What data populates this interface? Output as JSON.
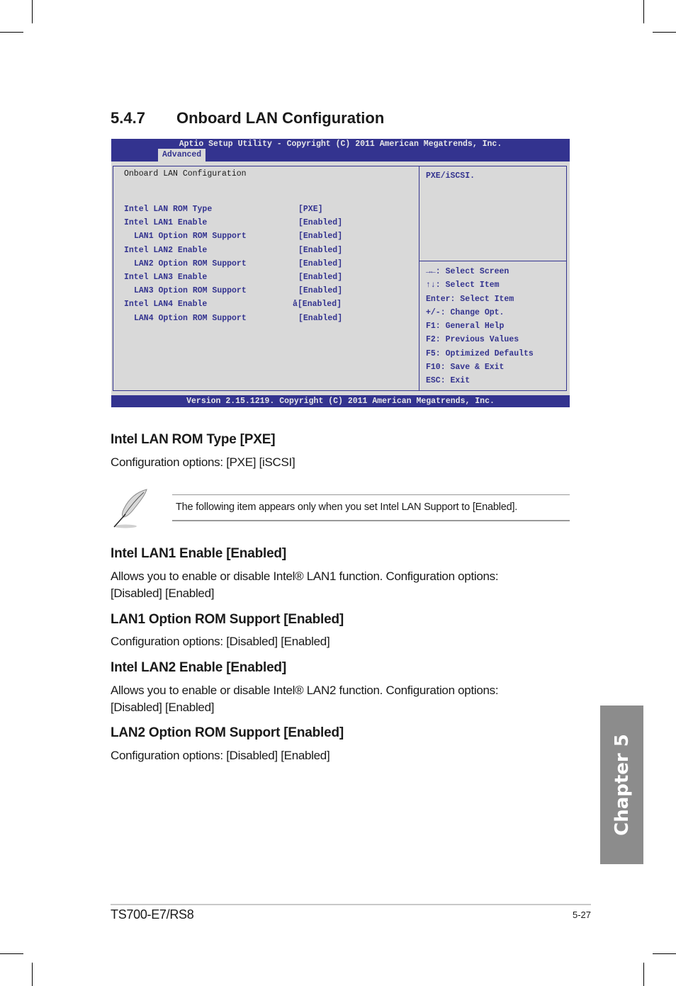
{
  "section": {
    "number": "5.4.7",
    "title": "Onboard LAN Configuration"
  },
  "bios": {
    "header_title": "Aptio Setup Utility - Copyright (C) 2011 American Megatrends, Inc.",
    "active_tab": "Advanced",
    "page_title": "Onboard LAN Configuration",
    "items": [
      {
        "label": "Intel LAN ROM Type",
        "value": "[PXE]",
        "indent": false
      },
      {
        "label": "Intel LAN1 Enable",
        "value": "[Enabled]",
        "indent": false
      },
      {
        "label": "LAN1 Option ROM Support",
        "value": "[Enabled]",
        "indent": true
      },
      {
        "label": "Intel LAN2 Enable",
        "value": "[Enabled]",
        "indent": false
      },
      {
        "label": "LAN2 Option ROM Support",
        "value": "[Enabled]",
        "indent": true
      },
      {
        "label": "Intel LAN3 Enable",
        "value": "[Enabled]",
        "indent": false
      },
      {
        "label": "LAN3 Option ROM Support",
        "value": "[Enabled]",
        "indent": true
      },
      {
        "label": "Intel LAN4 Enable",
        "value": "å[Enabled]",
        "indent": false
      },
      {
        "label": "LAN4 Option ROM Support",
        "value": "[Enabled]",
        "indent": true
      }
    ],
    "help_text": "PXE/iSCSI.",
    "key_help": [
      "→←: Select Screen",
      "↑↓: Select Item",
      "Enter: Select Item",
      "+/-: Change Opt.",
      "F1: General Help",
      "F2: Previous Values",
      "F5: Optimized Defaults",
      "F10: Save & Exit",
      "ESC: Exit"
    ],
    "footer": "Version 2.15.1219. Copyright (C) 2011 American Megatrends, Inc."
  },
  "sections": [
    {
      "heading": "Intel LAN ROM Type [PXE]",
      "body": "Configuration options: [PXE] [iSCSI]"
    },
    {
      "heading": "Intel LAN1 Enable [Enabled]",
      "body": "Allows you to enable or disable Intel® LAN1 function. Configuration options: [Disabled] [Enabled]"
    },
    {
      "heading": "LAN1 Option ROM Support [Enabled]",
      "body": "Configuration options: [Disabled] [Enabled]"
    },
    {
      "heading": "Intel LAN2 Enable [Enabled]",
      "body": "Allows you to enable or disable Intel® LAN2 function. Configuration options: [Disabled] [Enabled]"
    },
    {
      "heading": "LAN2 Option ROM Support [Enabled]",
      "body": "Configuration options: [Disabled] [Enabled]"
    }
  ],
  "note": {
    "icon": "pencil-note-icon",
    "text": "The following item appears only when you set Intel LAN Support to [Enabled]."
  },
  "chapter_tab": "Chapter 5",
  "footer": {
    "model": "TS700-E7/RS8",
    "page": "5-27"
  },
  "colors": {
    "bios_blue": "#33338f",
    "bios_bg": "#d9d9d9",
    "chapter_tab_gray": "#8c8c8c"
  }
}
